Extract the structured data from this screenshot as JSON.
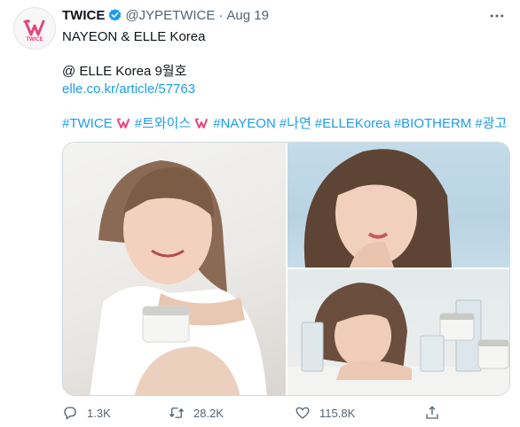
{
  "tweet": {
    "author_name": "TWICE",
    "handle": "@JYPETWICE",
    "separator": "·",
    "date": "Aug 19",
    "line1": "NAYEON & ELLE Korea",
    "line2": "@ ELLE Korea 9월호",
    "link": "elle.co.kr/article/57763",
    "hashtags": [
      "#TWICE",
      "#트와이스",
      "#NAYEON",
      "#나연",
      "#ELLEKorea",
      "#BIOTHERM",
      "#광고"
    ],
    "images": [
      {
        "name": "photo-nayeon-holding-cream"
      },
      {
        "name": "photo-nayeon-closeup"
      },
      {
        "name": "photo-nayeon-lying-with-products"
      }
    ],
    "actions": {
      "reply_count": "1.3K",
      "retweet_count": "28.2K",
      "like_count": "115.8K"
    }
  },
  "colors": {
    "link": "#1d9bf0",
    "verified": "#1d9bf0",
    "secondary_text": "#536471",
    "avatar_logo": "#e6447a"
  },
  "icons": [
    "twice-logo-icon",
    "verified-badge-icon",
    "more-options-icon",
    "twice-emoji-icon",
    "reply-icon",
    "retweet-icon",
    "like-icon",
    "share-icon"
  ]
}
